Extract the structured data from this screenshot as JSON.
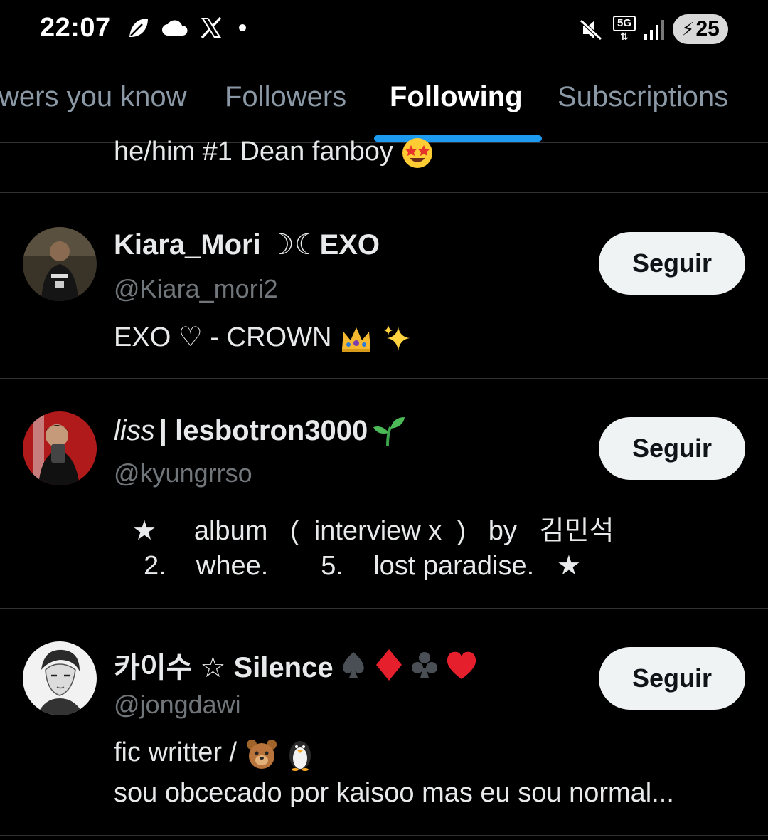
{
  "status": {
    "time": "22:07",
    "battery": "25",
    "network": "5G"
  },
  "tabs": [
    {
      "label": "Followers you know",
      "visible_label": "wers you know",
      "active": false
    },
    {
      "label": "Followers",
      "active": false
    },
    {
      "label": "Following",
      "active": true
    },
    {
      "label": "Subscriptions",
      "active": false
    }
  ],
  "partial_bio": "he/him #1 Dean fanboy",
  "users": [
    {
      "name": "Kiara_Mori ☽☾EXO",
      "handle": "@Kiara_mori2",
      "bio_lines": [
        "EXO ♡ - CROWN"
      ],
      "follow_label": "Seguir"
    },
    {
      "name_prefix": "liss",
      "name": " | lesbotron3000",
      "handle": "@kyungrrso",
      "bio_lines": [
        "★     album   (  interview x  )   by   김민석",
        "2.    whee.       5.    lost paradise.   ★"
      ],
      "follow_label": "Seguir"
    },
    {
      "name": "카이수 ☆ Silence",
      "handle": "@jongdawi",
      "bio_lines": [
        "fic writter /",
        "sou obcecado por kaisoo mas eu sou normal..."
      ],
      "follow_label": "Seguir"
    }
  ],
  "colors": {
    "background": "#000000",
    "accent": "#1d9bf0",
    "muted_text": "#71767b",
    "button_bg": "#eff3f4"
  }
}
